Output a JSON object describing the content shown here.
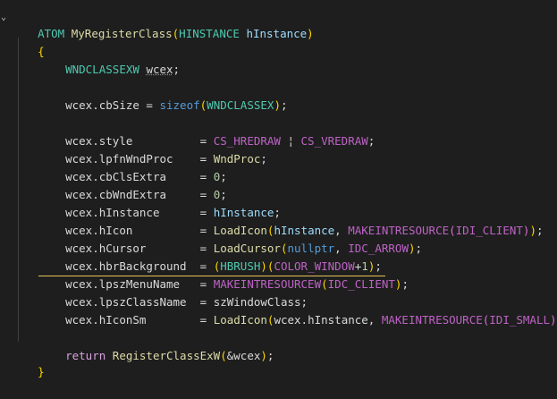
{
  "code": {
    "func_return_type": "ATOM",
    "func_name": "MyRegisterClass",
    "param_type": "HINSTANCE",
    "param_name": "hInstance",
    "open_brace": "{",
    "close_brace": "}",
    "decl_type": "WNDCLASSEXW",
    "decl_var": "wcex",
    "cbsize_lhs": "wcex.cbSize",
    "sizeof_kw": "sizeof",
    "sizeof_arg": "WNDCLASSEX",
    "style_lhs": "wcex.style",
    "hredraw": "CS_HREDRAW",
    "vredraw": "CS_VREDRAW",
    "wndproc_lhs": "wcex.lpfnWndProc",
    "wndproc_val": "WndProc",
    "clsextra_lhs": "wcex.cbClsExtra",
    "wndextra_lhs": "wcex.cbWndExtra",
    "zero": "0",
    "hinstance_lhs": "wcex.hInstance",
    "hicon_lhs": "wcex.hIcon",
    "loadicon": "LoadIcon",
    "makeintresource": "MAKEINTRESOURCE",
    "idi_client": "IDI_CLIENT",
    "hcursor_lhs": "wcex.hCursor",
    "loadcursor": "LoadCursor",
    "nullptr": "nullptr",
    "idc_arrow": "IDC_ARROW",
    "hbr_lhs": "wcex.hbrBackground",
    "hbrush": "HBRUSH",
    "color_window": "COLOR_WINDOW",
    "one": "1",
    "menuname_lhs": "wcex.lpszMenuName",
    "makeintresourcew": "MAKEINTRESOURCEW",
    "idc_client": "IDC_CLIENT",
    "classname_lhs": "wcex.lpszClassName",
    "classname_val": "szWindowClass",
    "hiconsm_lhs": "wcex.hIconSm",
    "wcex_hinstance": "wcex.hInstance",
    "idi_small": "IDI_SMALL",
    "return_kw": "return",
    "register_fn": "RegisterClassExW",
    "amp_wcex": "&wcex"
  }
}
